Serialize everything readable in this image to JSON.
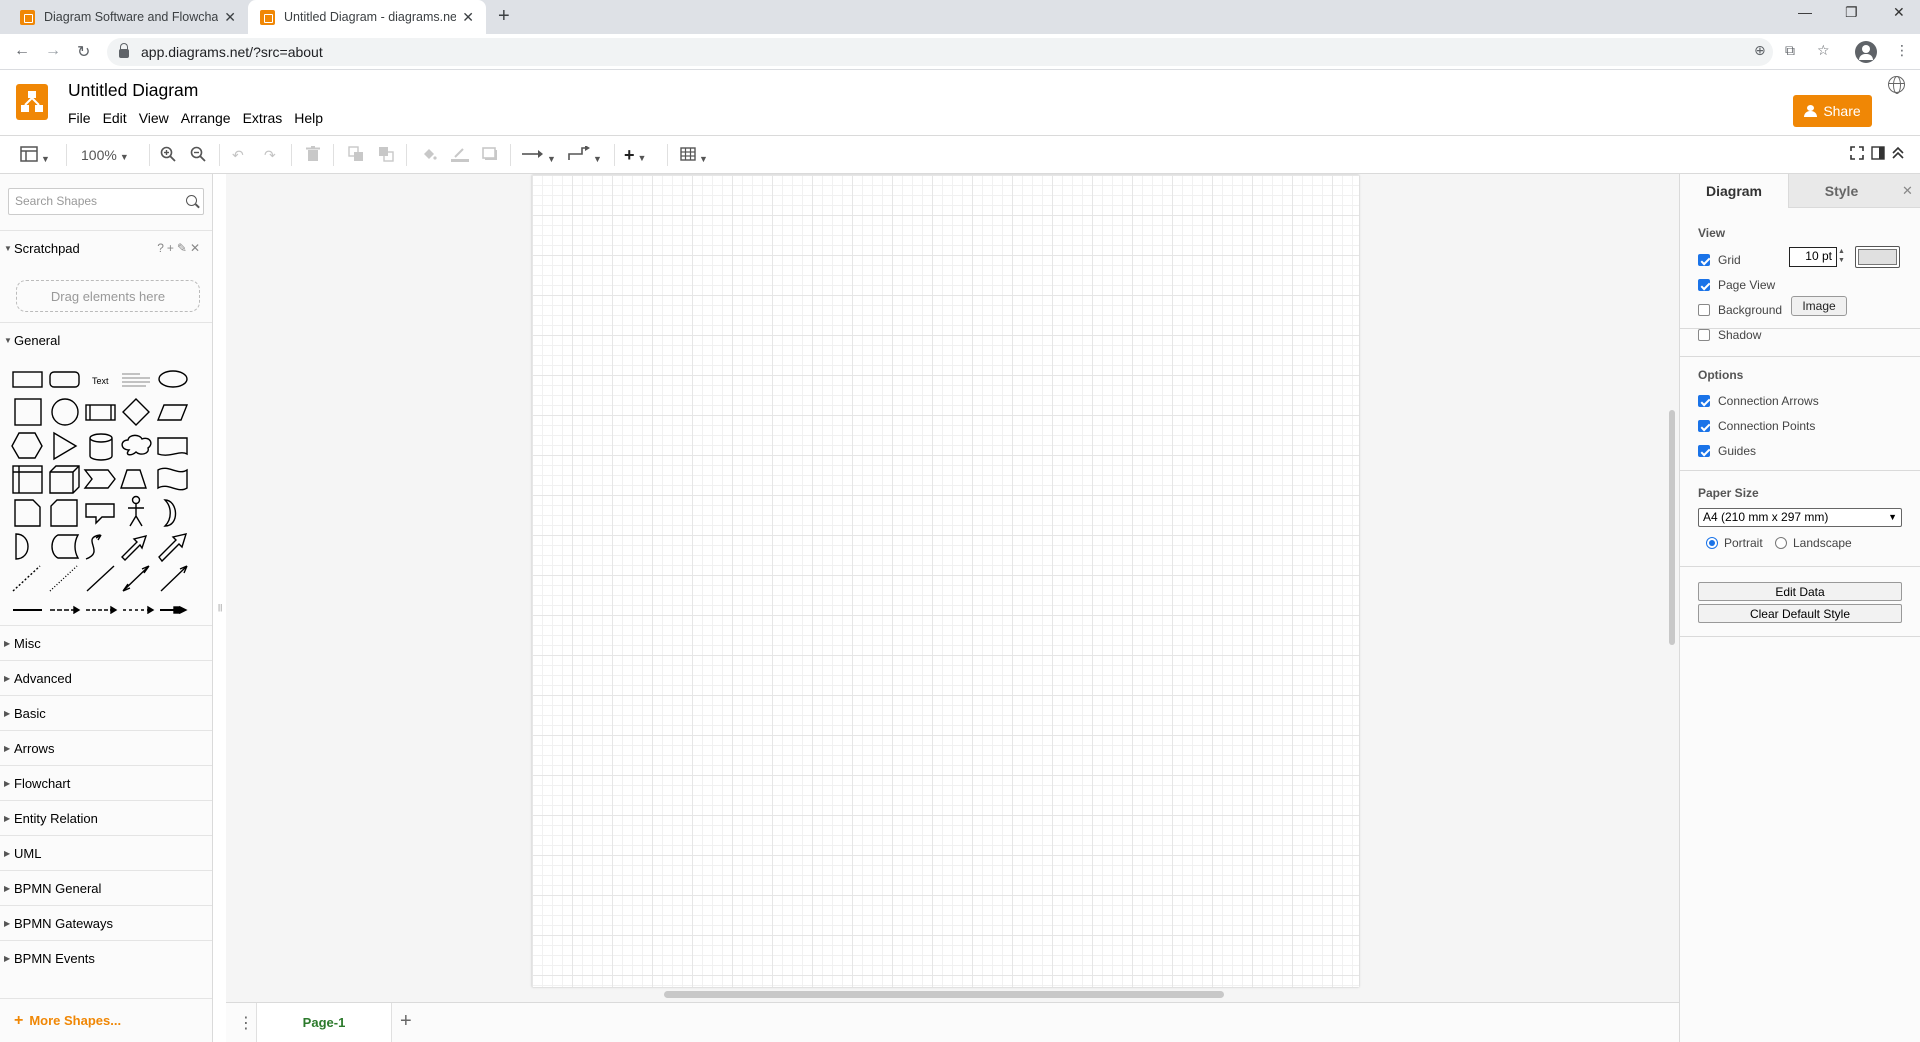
{
  "browser": {
    "tabs": [
      {
        "title": "Diagram Software and Flowchart Maker",
        "active": false
      },
      {
        "title": "Untitled Diagram - diagrams.net",
        "active": true
      }
    ],
    "url": "app.diagrams.net/?src=about"
  },
  "app": {
    "title": "Untitled Diagram",
    "brand_color": "#f08705",
    "menus": [
      "File",
      "Edit",
      "View",
      "Arrange",
      "Extras",
      "Help"
    ],
    "share_label": "Share"
  },
  "toolbar": {
    "zoom": "100%"
  },
  "sidebar": {
    "search_placeholder": "Search Shapes",
    "scratchpad": {
      "title": "Scratchpad",
      "drop_hint": "Drag elements here",
      "tools": "?+✎✕"
    },
    "general_title": "General",
    "text_shape_label": "Text",
    "sections": [
      "Misc",
      "Advanced",
      "Basic",
      "Arrows",
      "Flowchart",
      "Entity Relation",
      "UML",
      "BPMN General",
      "BPMN Gateways",
      "BPMN Events"
    ],
    "more_shapes": "More Shapes..."
  },
  "pages": {
    "tabs": [
      "Page-1"
    ]
  },
  "format_panel": {
    "tabs": [
      "Diagram",
      "Style"
    ],
    "view": {
      "title": "View",
      "grid": {
        "label": "Grid",
        "checked": true,
        "size": "10 pt"
      },
      "page_view": {
        "label": "Page View",
        "checked": true
      },
      "background": {
        "label": "Background",
        "checked": false,
        "button": "Image"
      },
      "shadow": {
        "label": "Shadow",
        "checked": false
      }
    },
    "options": {
      "title": "Options",
      "connection_arrows": {
        "label": "Connection Arrows",
        "checked": true
      },
      "connection_points": {
        "label": "Connection Points",
        "checked": true
      },
      "guides": {
        "label": "Guides",
        "checked": true
      }
    },
    "paper": {
      "title": "Paper Size",
      "selected": "A4 (210 mm x 297 mm)",
      "portrait": "Portrait",
      "landscape": "Landscape",
      "orientation": "portrait"
    },
    "edit_data": "Edit Data",
    "clear_default_style": "Clear Default Style"
  }
}
